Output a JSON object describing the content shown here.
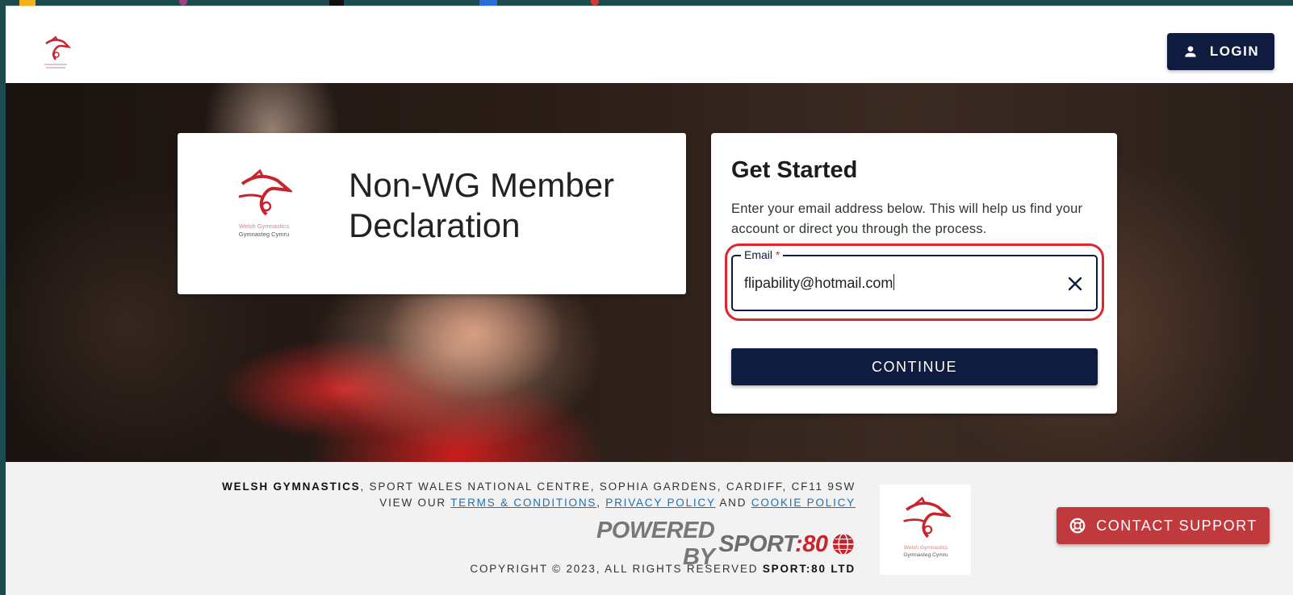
{
  "header": {
    "login_label": "LOGIN",
    "login_icon": "person-icon",
    "logo_icon": "welsh-gymnastics-logo"
  },
  "title_card": {
    "title": "Non-WG Member Declaration",
    "logo_line1": "Welsh Gymnastics",
    "logo_line2": "Gymnasteg Cymru"
  },
  "form": {
    "heading": "Get Started",
    "instructions": "Enter your email address below. This will help us find your account or direct you through the process.",
    "email_label": "Email",
    "email_required_marker": "*",
    "email_value": "flipability@hotmail.com",
    "clear_icon": "close-icon",
    "continue_label": "CONTINUE"
  },
  "footer": {
    "org_name": "WELSH GYMNASTICS",
    "address": ", SPORT WALES NATIONAL CENTRE, SOPHIA GARDENS, CARDIFF, CF11 9SW",
    "view_our": "VIEW OUR ",
    "terms_link": "TERMS & CONDITIONS",
    "comma": ", ",
    "privacy_link": "PRIVACY POLICY",
    "and": " AND ",
    "cookie_link": "COOKIE POLICY",
    "powered_by": "POWERED BY",
    "sport_text": "SPORT",
    "eighty_text": ":80",
    "copyright_prefix": "COPYRIGHT © 2023, ALL RIGHTS RESERVED ",
    "copyright_company": "SPORT:80 LTD",
    "logo_line1": "Welsh Gymnastics",
    "logo_line2": "Gymnasteg Cymru"
  },
  "support": {
    "label": "CONTACT SUPPORT",
    "icon": "lifebuoy-icon"
  },
  "colors": {
    "navy": "#0f1c3f",
    "brand_red": "#c8242c",
    "support_red": "#c0393c",
    "highlight_red": "#e0252e",
    "link_blue": "#1e6fb3"
  }
}
